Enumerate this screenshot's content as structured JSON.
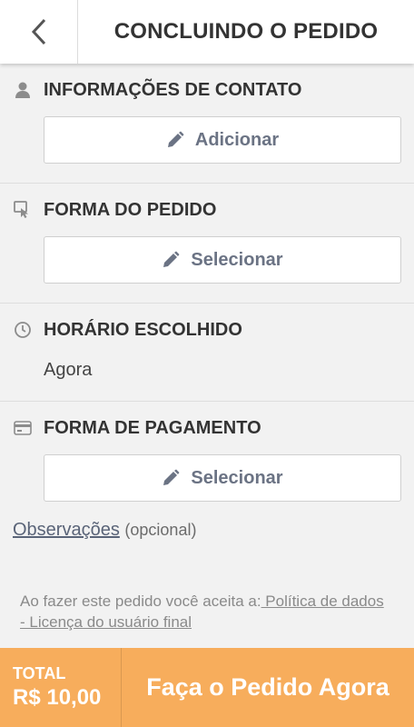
{
  "header": {
    "title": "CONCLUINDO O PEDIDO",
    "back_icon": "chevron-left-icon"
  },
  "contact": {
    "title": "INFORMAÇÕES DE CONTATO",
    "icon": "person-icon",
    "button_label": "Adicionar",
    "button_icon": "pencil-icon"
  },
  "order_type": {
    "title": "FORMA DO PEDIDO",
    "icon": "tap-icon",
    "button_label": "Selecionar",
    "button_icon": "pencil-icon"
  },
  "schedule": {
    "title": "HORÁRIO ESCOLHIDO",
    "icon": "clock-icon",
    "value": "Agora"
  },
  "payment": {
    "title": "FORMA DE PAGAMENTO",
    "icon": "credit-card-icon",
    "button_label": "Selecionar",
    "button_icon": "pencil-icon"
  },
  "notes": {
    "link": "Observações",
    "optional": "(opcional)"
  },
  "legal": {
    "intro": "Ao fazer este pedido você aceita a:",
    "privacy_link": " Política de dados",
    "terms_line": "- Licença do usuário final"
  },
  "footer": {
    "total_label": "TOTAL",
    "total_value": "R$ 10,00",
    "order_button": "Faça o Pedido Agora",
    "accent_color": "#f7ad5c"
  }
}
